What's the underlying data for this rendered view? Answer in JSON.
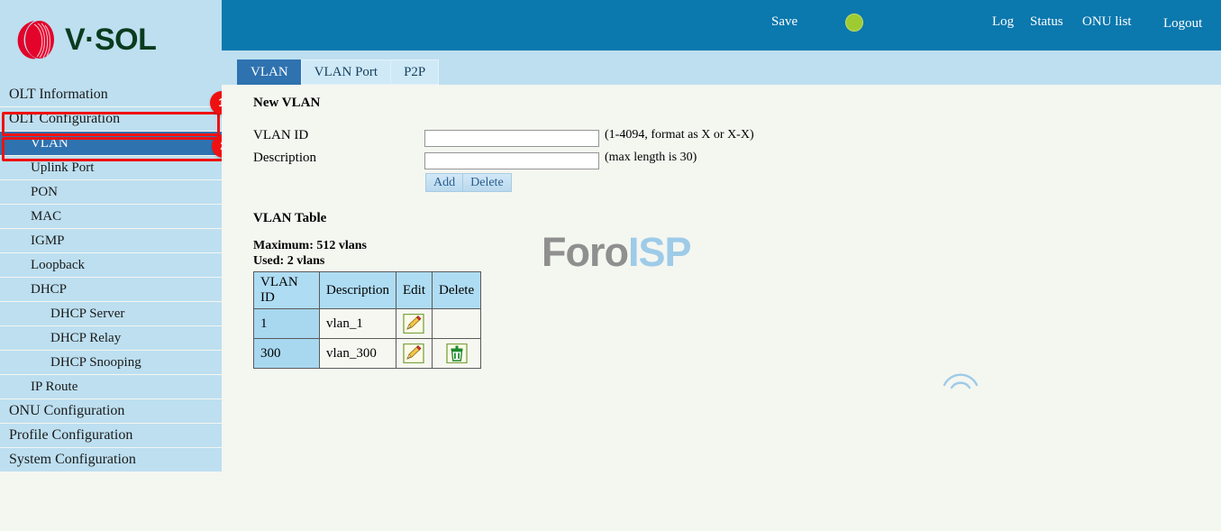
{
  "brand": {
    "name": "V·SOL",
    "logo_icon": "vsol-swirl-logo-icon"
  },
  "header": {
    "save_label": "Save",
    "status_indicator_icon": "green-status-dot-icon",
    "status_indicator_color": "#9ecb31",
    "links": [
      "Log",
      "Status",
      "ONU list",
      "Logout"
    ],
    "log_label": "Log",
    "status_label": "Status",
    "onu_list_label": "ONU list",
    "logout_label": "Logout",
    "background_color": "#0b78ae"
  },
  "tabs": [
    {
      "label": "VLAN",
      "active": true
    },
    {
      "label": "VLAN Port",
      "active": false
    },
    {
      "label": "P2P",
      "active": false
    }
  ],
  "sidebar": {
    "items": [
      {
        "label": "OLT Information",
        "level": 0,
        "selected": false
      },
      {
        "label": "OLT Configuration",
        "level": 0,
        "selected": false
      },
      {
        "label": "VLAN",
        "level": 1,
        "selected": true
      },
      {
        "label": "Uplink Port",
        "level": 1,
        "selected": false
      },
      {
        "label": "PON",
        "level": 1,
        "selected": false
      },
      {
        "label": "MAC",
        "level": 1,
        "selected": false
      },
      {
        "label": "IGMP",
        "level": 1,
        "selected": false
      },
      {
        "label": "Loopback",
        "level": 1,
        "selected": false
      },
      {
        "label": "DHCP",
        "level": 1,
        "selected": false
      },
      {
        "label": "DHCP Server",
        "level": 2,
        "selected": false
      },
      {
        "label": "DHCP Relay",
        "level": 2,
        "selected": false
      },
      {
        "label": "DHCP Snooping",
        "level": 2,
        "selected": false
      },
      {
        "label": "IP Route",
        "level": 1,
        "selected": false
      },
      {
        "label": "ONU Configuration",
        "level": 0,
        "selected": false
      },
      {
        "label": "Profile Configuration",
        "level": 0,
        "selected": false
      },
      {
        "label": "System Configuration",
        "level": 0,
        "selected": false
      }
    ]
  },
  "annotations": {
    "color": "#ef1111",
    "markers": [
      {
        "number": "1",
        "target": "OLT Configuration"
      },
      {
        "number": "2",
        "target": "VLAN"
      }
    ],
    "badge_1": "1",
    "badge_2": "2"
  },
  "main": {
    "new_vlan": {
      "title": "New VLAN",
      "vlan_id_label": "VLAN ID",
      "vlan_id_value": "",
      "vlan_id_hint": "(1-4094, format as X or X-X)",
      "description_label": "Description",
      "description_value": "",
      "description_hint": "(max length is 30)",
      "add_label": "Add",
      "delete_label": "Delete"
    },
    "vlan_table": {
      "title": "VLAN Table",
      "maximum_text": "Maximum: 512 vlans",
      "used_text": "Used: 2 vlans",
      "columns": [
        "VLAN ID",
        "Description",
        "Edit",
        "Delete"
      ],
      "rows": [
        {
          "vlan_id": "1",
          "description": "vlan_1",
          "edit_icon": "pencil-edit-icon",
          "delete_icon": null
        },
        {
          "vlan_id": "300",
          "description": "vlan_300",
          "edit_icon": "pencil-edit-icon",
          "delete_icon": "trash-delete-icon"
        }
      ]
    }
  },
  "watermark": {
    "text_primary": "Foro",
    "text_secondary": "ISP",
    "wifi_icon": "wifi-waves-icon"
  }
}
